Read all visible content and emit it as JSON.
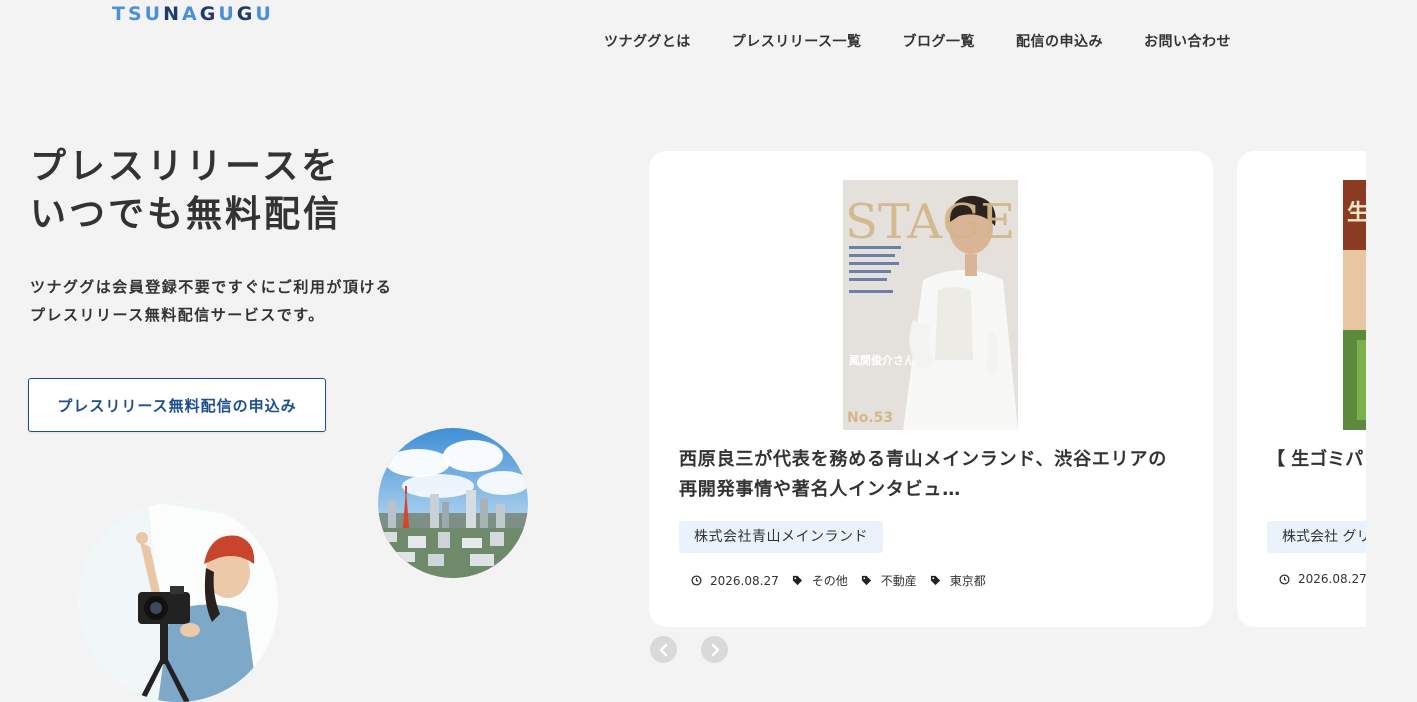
{
  "brand": {
    "logo_letters": [
      "T",
      "S",
      "U",
      "N",
      "A",
      "G",
      "U",
      "G",
      "U"
    ],
    "logo_colors": [
      "#4a90d9",
      "#4a90d9",
      "#4a90d9",
      "#1f3a6e",
      "#4a90d9",
      "#1f3a6e",
      "#4a90d9",
      "#1f3a6e",
      "#4a90d9"
    ]
  },
  "nav": {
    "items": [
      {
        "label": "ツナググとは"
      },
      {
        "label": "プレスリリース一覧"
      },
      {
        "label": "ブログ一覧"
      },
      {
        "label": "配信の申込み"
      },
      {
        "label": "お問い合わせ"
      }
    ]
  },
  "hero": {
    "title_line1": "プレスリリースを",
    "title_line2": "いつでも無料配信",
    "desc_line1": "ツナググは会員登録不要ですぐにご利用が頂ける",
    "desc_line2": "プレスリリース無料配信サービスです。",
    "cta_label": "プレスリリース無料配信の申込み"
  },
  "cards": [
    {
      "cover": {
        "masthead": "STAGE",
        "issue": "No.53",
        "person_name": "風間俊介さん"
      },
      "title_line1": "西原良三が代表を務める青山メインランド、渋谷エリアの",
      "title_line2": "再開発事情や著名人インタビュ…",
      "company": "株式会社青山メインランド",
      "date": "2026.08.27",
      "tags": [
        "その他",
        "不動産",
        "東京都"
      ]
    },
    {
      "cover": {
        "label": "生"
      },
      "title": "【 生ゴミパ",
      "company": "株式会社 グリ",
      "date": "2026.08.27"
    }
  ],
  "colors": {
    "accent_blue": "#1d4f8f",
    "tag_bg": "#eaf3fb",
    "page_bg": "#f3f3f3"
  },
  "icons": {
    "date": "clock-icon",
    "tag": "tag-icon",
    "prev": "chevron-left-icon",
    "next": "chevron-right-icon"
  }
}
